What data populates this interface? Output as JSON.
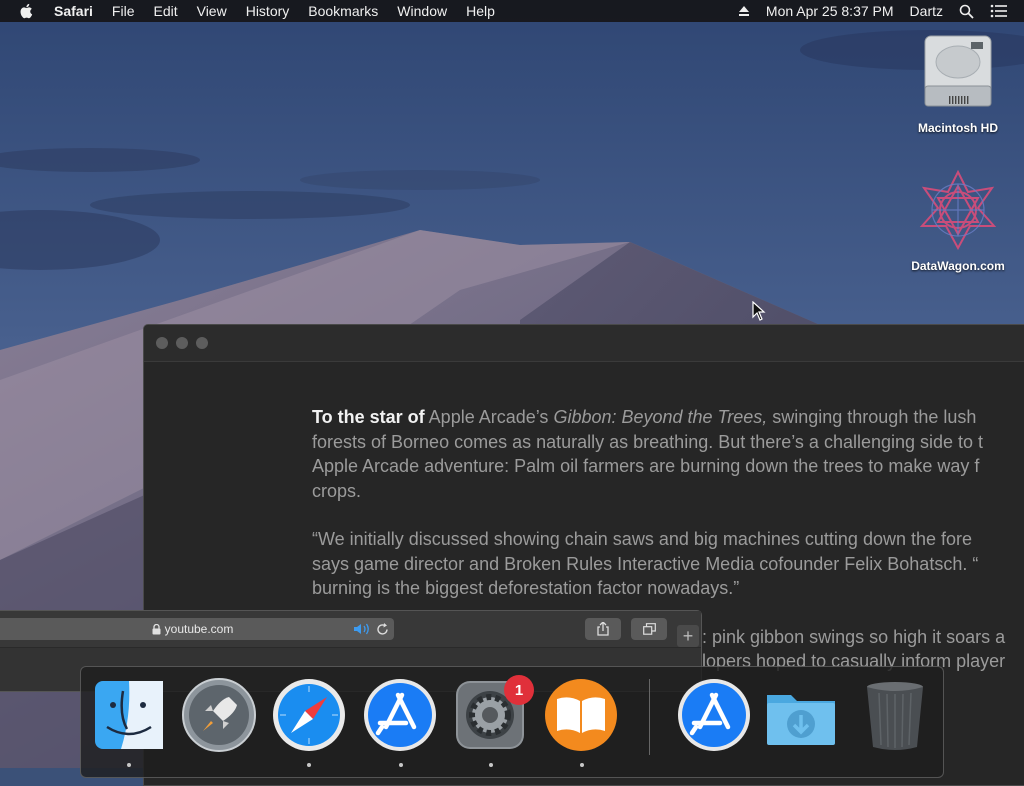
{
  "menubar": {
    "app_name": "Safari",
    "items": [
      "File",
      "Edit",
      "View",
      "History",
      "Bookmarks",
      "Window",
      "Help"
    ],
    "clock": "Mon Apr 25  8:37 PM",
    "user": "Dartz"
  },
  "desktop": {
    "icons": [
      {
        "label": "Macintosh HD",
        "icon": "hard-drive-icon"
      },
      {
        "label": "DataWagon.com",
        "icon": "datawagon-logo-icon"
      }
    ]
  },
  "reader": {
    "lead": "To the star of",
    "para1_line1_rest": " Apple Arcade’s ",
    "para1_title": "Gibbon: Beyond the Trees,",
    "para1_line1_tail": " swinging through the lush",
    "para1_line2": "forests of Borneo comes as naturally as breathing. But there’s a challenging side to t",
    "para1_line3": "Apple Arcade adventure: Palm oil farmers are burning down the trees to make way f",
    "para1_line4": "crops.",
    "para2_line1": "“We initially discussed showing chain saws and big machines cutting down the fore",
    "para2_line2": "says game director and Broken Rules Interactive Media cofounder Felix Bohatsch. “",
    "para2_line3": "burning is the biggest deforestation factor nowadays.”",
    "para3_line1": ": pink gibbon swings so high it soars a",
    "para3_line2": "lopers hoped to casually inform player"
  },
  "safari_mini": {
    "address": "youtube.com"
  },
  "dock": {
    "apps": [
      {
        "name": "Finder",
        "icon": "finder-icon",
        "running": true
      },
      {
        "name": "Launchpad",
        "icon": "launchpad-icon",
        "running": false
      },
      {
        "name": "Safari",
        "icon": "safari-icon",
        "running": true
      },
      {
        "name": "App Store",
        "icon": "app-store-icon",
        "running": true
      },
      {
        "name": "System Preferences",
        "icon": "system-preferences-icon",
        "running": true,
        "badge": "1"
      },
      {
        "name": "Books",
        "icon": "books-icon",
        "running": true
      },
      {
        "name": "App Store",
        "icon": "app-store-download-icon",
        "running": false
      },
      {
        "name": "Downloads",
        "icon": "downloads-folder-icon",
        "running": false
      },
      {
        "name": "Trash",
        "icon": "trash-icon",
        "running": false
      }
    ]
  },
  "colors": {
    "menubar_bg": "#161618",
    "reader_bg": "#262626",
    "badge_red": "#e0303a",
    "accent_blue": "#1a7cf5"
  }
}
